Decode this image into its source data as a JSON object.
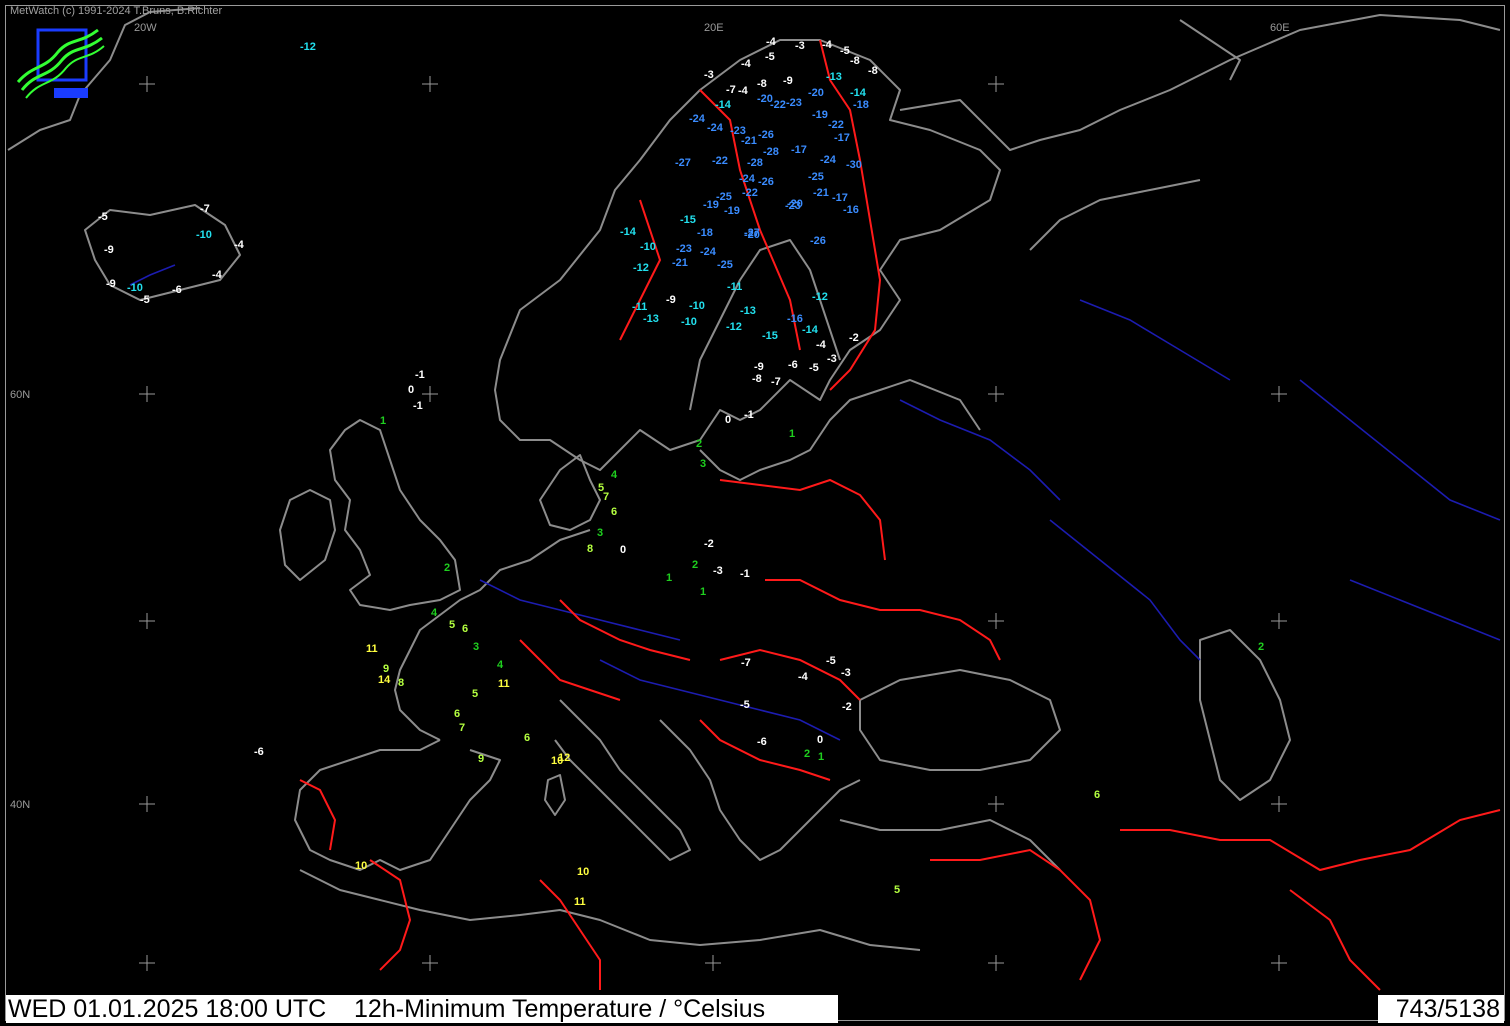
{
  "app": {
    "credit": "MetWatch  (c) 1991-2024 T.Bruns, B.Richter"
  },
  "status": {
    "datetime": "WED 01.01.2025 18:00 UTC",
    "product": "12h-Minimum Temperature / °Celsius",
    "counter": "743/5138"
  },
  "grid_labels": {
    "lon_20w": "20W",
    "lon_20e": "20E",
    "lon_60e": "60E",
    "lat_60n": "60N",
    "lat_40n": "40N"
  },
  "colors": {
    "background": "#000000",
    "coastline": "#8c8c8c",
    "border": "#ff1a1a",
    "river": "#1c1cb0",
    "temp_very_cold": "#3a8cff",
    "temp_cold": "#22e0ee",
    "temp_freezing": "#ffffff",
    "temp_cool": "#1fcf1f",
    "temp_mild": "#b4ff40",
    "temp_warm": "#ffff40"
  },
  "stations": [
    "-12",
    "-5",
    "-7",
    "-10",
    "-4",
    "-9",
    "-4",
    "-9",
    "-10",
    "-5",
    "-6",
    "-6",
    "-1",
    "0",
    "-1",
    "1",
    "-4",
    "-3",
    "-4",
    "-5",
    "-8",
    "-8",
    "-4",
    "-5",
    "-9",
    "-8",
    "-13",
    "-14",
    "-18",
    "-3",
    "-7",
    "-4",
    "-20",
    "-20",
    "-23",
    "-22",
    "-14",
    "-24",
    "-24",
    "-23",
    "-21",
    "-26",
    "-28",
    "-19",
    "-22",
    "-17",
    "-27",
    "-22",
    "-28",
    "-24",
    "-26",
    "-25",
    "-17",
    "-24",
    "-30",
    "-25",
    "-15",
    "-18",
    "-19",
    "-20",
    "-23",
    "-22",
    "-19",
    "-20",
    "-21",
    "-16",
    "-17",
    "-26",
    "-23",
    "-24",
    "-25",
    "-27",
    "-21",
    "-14",
    "-12",
    "-10",
    "-11",
    "-13",
    "-9",
    "-10",
    "-10",
    "-12",
    "-11",
    "-12",
    "-13",
    "-15",
    "-16",
    "-14",
    "-9",
    "-8",
    "-7",
    "-6",
    "-5",
    "-4",
    "-3",
    "-2",
    "-1",
    "0",
    "1",
    "2",
    "3",
    "4",
    "5",
    "6",
    "7",
    "8",
    "3",
    "0",
    "2",
    "1",
    "-2",
    "-3",
    "-1",
    "1",
    "2",
    "4",
    "5",
    "6",
    "3",
    "4",
    "5",
    "6",
    "7",
    "6",
    "10",
    "11",
    "12",
    "10",
    "11",
    "9",
    "8",
    "14",
    "11",
    "10",
    "9",
    "2",
    "6",
    "5",
    "-5",
    "-3",
    "-2",
    "-4",
    "-7",
    "-6",
    "-5",
    "2",
    "0",
    "1"
  ]
}
